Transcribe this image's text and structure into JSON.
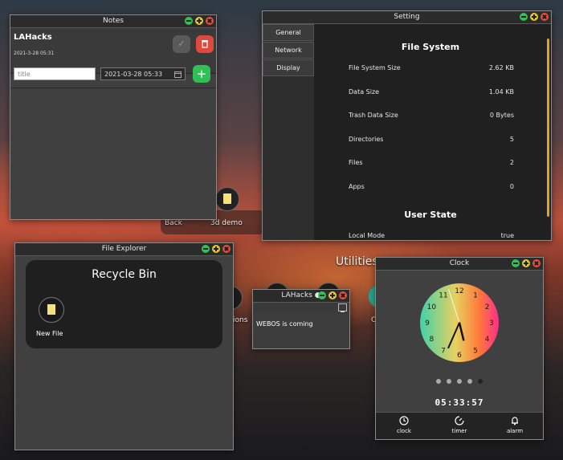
{
  "desktop": {
    "icons": [
      {
        "label": "Back"
      },
      {
        "label": "3d demo"
      },
      {
        "label": "ions"
      },
      {
        "label": "C"
      }
    ],
    "section_label": "Utilities"
  },
  "notes_window": {
    "title": "Notes",
    "note": {
      "title": "LAHacks",
      "date": "2021-3-28 05:31"
    },
    "title_input_placeholder": "title",
    "date_input_value": "2021-03-28 05:33"
  },
  "setting_window": {
    "title": "Setting",
    "tabs": [
      {
        "label": "General"
      },
      {
        "label": "Network"
      },
      {
        "label": "Display"
      }
    ],
    "file_system_heading": "File System",
    "rows": [
      {
        "label": "File System Size",
        "value": "2.62 KB"
      },
      {
        "label": "Data Size",
        "value": "1.04 KB"
      },
      {
        "label": "Trash Data Size",
        "value": "0 Bytes"
      },
      {
        "label": "Directories",
        "value": "5"
      },
      {
        "label": "Files",
        "value": "2"
      },
      {
        "label": "Apps",
        "value": "0"
      }
    ],
    "user_state_heading": "User State",
    "user_rows": [
      {
        "label": "Local Mode",
        "value": "true"
      }
    ]
  },
  "file_explorer_window": {
    "title": "File Explorer",
    "folder_title": "Recycle Bin",
    "files": [
      {
        "label": "New File"
      }
    ]
  },
  "small_note_window": {
    "title": "LAHacks ●",
    "content": "WEBOS is coming"
  },
  "clock_window": {
    "title": "Clock",
    "dial_numbers": [
      "12",
      "1",
      "2",
      "3",
      "4",
      "5",
      "6",
      "7",
      "8",
      "9",
      "10",
      "11"
    ],
    "time": {
      "hours": 5,
      "minutes": 33,
      "seconds": 57
    },
    "digital_time": "05:33:57",
    "page_dots": 5,
    "active_dot": 4,
    "nav": [
      {
        "label": "clock"
      },
      {
        "label": "timer"
      },
      {
        "label": "alarm"
      }
    ]
  }
}
